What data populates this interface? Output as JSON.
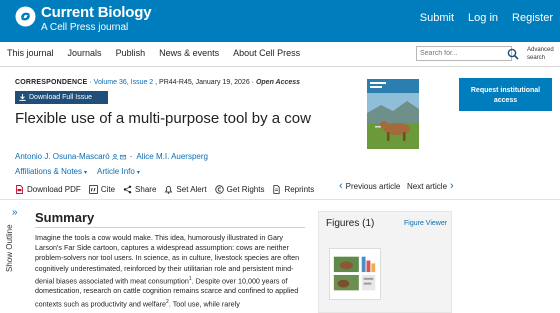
{
  "header": {
    "title": "Current Biology",
    "subtitle": "A Cell Press journal",
    "links": [
      "Submit",
      "Log in",
      "Register"
    ]
  },
  "nav": {
    "items": [
      "This journal",
      "Journals",
      "Publish",
      "News & events",
      "About Cell Press"
    ],
    "search_placeholder": "Search for...",
    "advanced_search": "Advanced search"
  },
  "article": {
    "type": "CORRESPONDENCE",
    "volume": "Volume 36, Issue 2",
    "pages": "PR44-R45, January 19, 2026",
    "access": "Open Access",
    "download_issue": "Download Full Issue",
    "title": "Flexible use of a multi-purpose tool by a cow",
    "authors": [
      "Antonio J. Osuna-Mascaró",
      "Alice M.I. Auersperg"
    ],
    "affiliations_label": "Affiliations & Notes",
    "article_info_label": "Article Info"
  },
  "sidebar": {
    "request_access": "Request institutional access"
  },
  "toolbar": {
    "download_pdf": "Download PDF",
    "cite": "Cite",
    "share": "Share",
    "set_alert": "Set Alert",
    "get_rights": "Get Rights",
    "reprints": "Reprints",
    "previous_article": "Previous article",
    "next_article": "Next article"
  },
  "outline": {
    "label": "Show Outline"
  },
  "summary": {
    "heading": "Summary",
    "p1": "Imagine the tools a cow would make. This idea, humorously illustrated in Gary Larson's Far Side cartoon, captures a widespread assumption: cows are neither problem-solvers nor tool users. In science, as in culture, livestock species are often cognitively underestimated, reinforced by their utilitarian role and persistent mind-denial biases associated with meat consumption",
    "sup1": "1",
    "p2": ". Despite over 10,000 years of domestication, research on cattle cognition remains scarce and confined to applied contexts such as productivity and welfare",
    "sup2": "2",
    "p3": ". Tool use, while rarely"
  },
  "figures": {
    "heading": "Figures (1)",
    "viewer": "Figure Viewer"
  },
  "colors": {
    "brand_blue": "#007DBC",
    "link_blue": "#0a6db5",
    "dark_button": "#1f4e79",
    "pdf_red": "#c8102e"
  }
}
